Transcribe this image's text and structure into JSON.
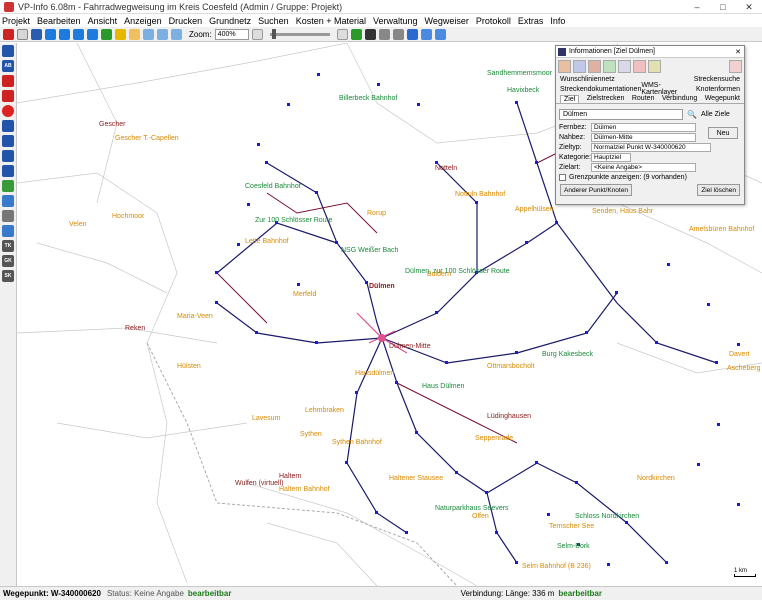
{
  "window": {
    "title": "VP-Info 6.08m - Fahrradwegweisung im Kreis Coesfeld (Admin / Gruppe: Projekt)",
    "controls": [
      "–",
      "□",
      "✕"
    ]
  },
  "menu": [
    "Projekt",
    "Bearbeiten",
    "Ansicht",
    "Anzeigen",
    "Drucken",
    "Grundnetz",
    "Suchen",
    "Kosten + Material",
    "Verwaltung",
    "Wegweiser",
    "Protokoll",
    "Extras",
    "Info"
  ],
  "toolbar": {
    "zoom_label": "Zoom:",
    "zoom_value": "400%"
  },
  "left_tools": [
    "AB",
    "TK",
    "GK",
    "SK"
  ],
  "map": {
    "places_orange": [
      {
        "name": "Gescher T.-Capellen"
      },
      {
        "name": "Hochmoor"
      },
      {
        "name": "Velen"
      },
      {
        "name": "Lette Bahnhof"
      },
      {
        "name": "Maria-Veen"
      },
      {
        "name": "Hülsten"
      },
      {
        "name": "Lavesum"
      },
      {
        "name": "Lehmbraken"
      },
      {
        "name": "Sythen"
      },
      {
        "name": "Sythen Bahnhof"
      },
      {
        "name": "Haltern Bahnhof"
      },
      {
        "name": "Hausdülmen"
      },
      {
        "name": "Sendenhorst"
      },
      {
        "name": "Senden, Haus Bahr"
      },
      {
        "name": "Amelsbüren Bahnhof"
      },
      {
        "name": "Appelhülsen"
      },
      {
        "name": "Ottmarsbocholt"
      },
      {
        "name": "Lüdinghausen"
      },
      {
        "name": "Seppenrade"
      },
      {
        "name": "Haltener Stausee"
      },
      {
        "name": "Selm Bahnhof (B 236)"
      },
      {
        "name": "Olfen"
      },
      {
        "name": "Nordkirchen"
      },
      {
        "name": "Ternscher See"
      },
      {
        "name": "Nottuln Bahnhof"
      },
      {
        "name": "Buldern"
      },
      {
        "name": "Rorup"
      },
      {
        "name": "Merfeld"
      },
      {
        "name": "Davert"
      },
      {
        "name": "Ascheberg"
      }
    ],
    "places_green": [
      {
        "name": "Coesfeld Bahnhof"
      },
      {
        "name": "Zur 100 Schlösser Route"
      },
      {
        "name": "NSG Weißer Bach"
      },
      {
        "name": "Dülmen, zur 100 Schlösser Route"
      },
      {
        "name": "Burg Kakesbeck"
      },
      {
        "name": "Haus Dülmen"
      },
      {
        "name": "Naturparkhaus Seevers"
      },
      {
        "name": "Schloss Nordkirchen"
      },
      {
        "name": "Selm-Bork"
      },
      {
        "name": "Billerbeck Bahnhof"
      },
      {
        "name": "Havixbeck"
      },
      {
        "name": "Sandhemmemsmoor"
      }
    ],
    "places_dark": [
      {
        "name": "Gescher"
      },
      {
        "name": "Reken"
      },
      {
        "name": "Wulfen (virtuell)"
      },
      {
        "name": "Haltern"
      },
      {
        "name": "Dülmen"
      },
      {
        "name": "Notteln"
      },
      {
        "name": "Lüdinghausen"
      },
      {
        "name": "Dülmen-Mitte"
      }
    ],
    "scale_label": "1 km"
  },
  "info_panel": {
    "title": "Informationen [Ziel Dülmen]",
    "tab_rows": [
      [
        "Wunschliniennetz",
        "Streckensuche"
      ],
      [
        "Streckendokumentationen",
        "WMS-Kartenlayer",
        "Knotenformen"
      ],
      [
        "Ziel",
        "Zielstrecken",
        "Routen",
        "Verbindung",
        "Wegepunkt"
      ]
    ],
    "search_value": "Dülmen",
    "filter": "Alle Ziele",
    "fields": [
      {
        "label": "Fernbez:",
        "value": "Dülmen"
      },
      {
        "label": "Nahbez:",
        "value": "Dülmen-Mitte"
      },
      {
        "label": "Zieltyp:",
        "value": "Normalziel   Punkt  W-340000620"
      },
      {
        "label": "Kategorie:",
        "value": "Hauptziel"
      },
      {
        "label": "Zielart:",
        "value": "<Keine Angabe>"
      }
    ],
    "new_button": "Neu",
    "checkbox_label": "Grenzpunkte anzeigen: (9 vorhanden)",
    "btn_other": "Anderer Punkt/Knoten",
    "btn_delete": "Ziel löschen"
  },
  "status": {
    "waypoint": "Wegepunkt: W-340000620",
    "status_text": "Status: Keine Angabe",
    "status_ok": "bearbeitbar",
    "connection": "Verbindung: Länge: 336 m",
    "connection_ok": "bearbeitbar"
  }
}
